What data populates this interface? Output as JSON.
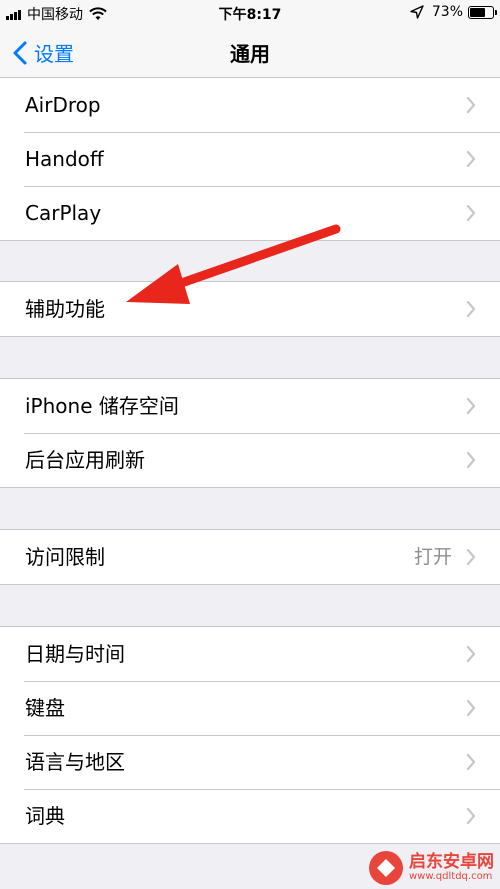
{
  "status_bar": {
    "carrier": "中国移动",
    "time": "下午8:17",
    "battery": "73%",
    "battery_level": 0.73,
    "icons": [
      "signal-icon",
      "wifi-icon",
      "location-icon",
      "battery-icon"
    ]
  },
  "nav": {
    "back_label": "设置",
    "title": "通用"
  },
  "groups": [
    {
      "rows": [
        {
          "label": "AirDrop"
        },
        {
          "label": "Handoff"
        },
        {
          "label": "CarPlay"
        }
      ]
    },
    {
      "rows": [
        {
          "label": "辅助功能"
        }
      ]
    },
    {
      "rows": [
        {
          "label": "iPhone 储存空间"
        },
        {
          "label": "后台应用刷新"
        }
      ]
    },
    {
      "rows": [
        {
          "label": "访问限制",
          "detail": "打开"
        }
      ]
    },
    {
      "rows": [
        {
          "label": "日期与时间"
        },
        {
          "label": "键盘"
        },
        {
          "label": "语言与地区"
        },
        {
          "label": "词典"
        }
      ]
    }
  ],
  "annotation": {
    "arrow_color": "#e8261c"
  },
  "watermark": {
    "name": "启东安卓网",
    "url": "www.qdltdq.com"
  },
  "colors": {
    "accent": "#007aff",
    "background": "#efeff4",
    "separator": "#c8c7cc",
    "chevron": "#c7c7cc"
  }
}
